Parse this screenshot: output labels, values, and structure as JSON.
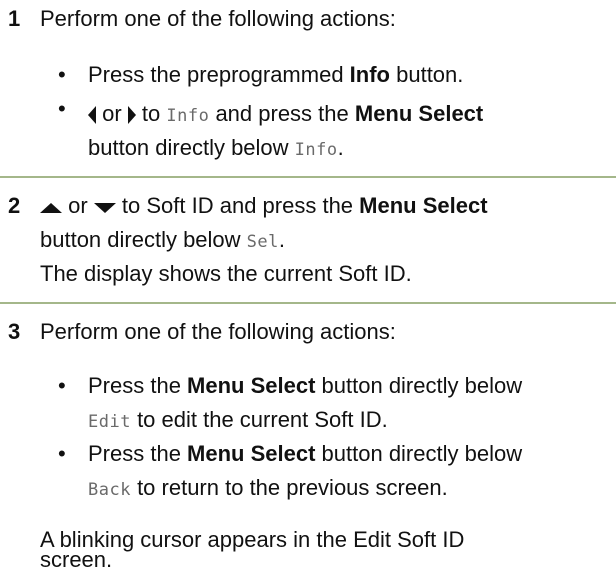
{
  "step1": {
    "number": "1",
    "intro": "Perform one of the following actions:",
    "bullet_char": "•",
    "b1_pre": "Press the preprogrammed ",
    "b1_bold": "Info",
    "b1_post": " button.",
    "b2_or": " or ",
    "b2_to": " to ",
    "b2_code": "Info",
    "b2_mid": " and press the ",
    "b2_bold": "Menu Select",
    "b2_line2": "button directly below ",
    "b2_code2": "Info",
    "b2_end": "."
  },
  "step2": {
    "number": "2",
    "or": " or ",
    "to_soft": " to Soft ID and press the ",
    "bold": "Menu Select",
    "line2_pre": "button directly below ",
    "code": "Sel",
    "line2_end": ".",
    "line3": "The display shows the current Soft ID."
  },
  "step3": {
    "number": "3",
    "intro": "Perform one of the following actions:",
    "bullet_char": "•",
    "b1_pre": "Press the ",
    "b1_bold": "Menu Select",
    "b1_post": " button directly below",
    "b1_code": "Edit",
    "b1_line2": " to edit the current Soft ID.",
    "b2_pre": "Press the ",
    "b2_bold": "Menu Select",
    "b2_post": " button directly below",
    "b2_code": "Back",
    "b2_line2": " to return to the previous screen.",
    "result_line1": "A blinking cursor appears in the Edit Soft ID",
    "result_line2": "screen."
  },
  "icons": {
    "left": "left-arrow-icon",
    "right": "right-arrow-icon",
    "up": "up-arrow-icon",
    "down": "down-arrow-icon"
  },
  "colors": {
    "separator": "#a4b78a",
    "code_text": "#6a6a6a"
  }
}
